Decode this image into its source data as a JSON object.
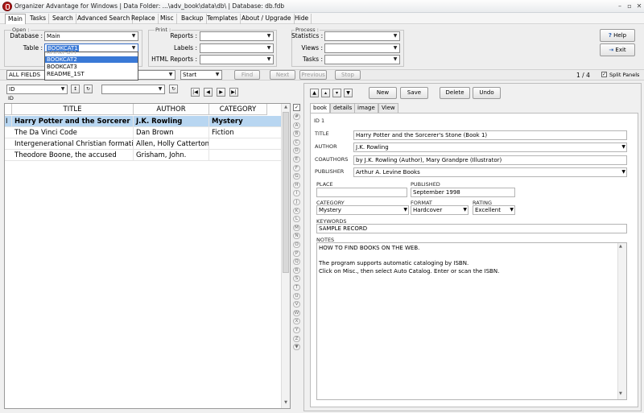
{
  "window": {
    "title": "Organizer Advantage for Windows | Data Folder: ...\\adv_book\\data\\db\\ | Database: db.fdb",
    "minimize": "–",
    "restore": "▫",
    "close": "✕"
  },
  "menu": [
    "Main",
    "Tasks",
    "Search",
    "Advanced Search",
    "Replace",
    "Misc",
    "Backup",
    "Templates",
    "About / Upgrade",
    "Hide"
  ],
  "open_group": {
    "label": "Open :",
    "database_label": "Database :",
    "database_value": "Main",
    "table_label": "Table :",
    "table_value": "BOOKCAT1",
    "table_options": [
      "BOOKCAT1",
      "BOOKCAT2",
      "BOOKCAT3",
      "README_1ST"
    ]
  },
  "print_group": {
    "label": "Print :",
    "reports_label": "Reports :",
    "labels_label": "Labels :",
    "html_reports_label": "HTML Reports :"
  },
  "process_group": {
    "label": "Process :",
    "statistics_label": "Statistics :",
    "views_label": "Views :",
    "tasks_label": "Tasks :"
  },
  "help_button": "Help",
  "exit_button": "Exit",
  "search_bar": {
    "field": "ALL FIELDS",
    "position": "Start",
    "find": "Find",
    "next": "Next",
    "previous": "Previous",
    "stop": "Stop"
  },
  "record_count": "1 / 4",
  "split_panels": "Split Panels",
  "sort_field": "ID",
  "sort_field_small": "ID",
  "grid": {
    "headers": [
      "TITLE",
      "AUTHOR",
      "CATEGORY"
    ],
    "indicator": "I",
    "rows": [
      [
        "Harry Potter and the Sorcerer",
        "J.K. Rowling",
        "Mystery"
      ],
      [
        "The Da Vinci Code",
        "Dan Brown",
        "Fiction"
      ],
      [
        "Intergenerational Christian formati",
        "Allen, Holly Catterton",
        ""
      ],
      [
        "Theodore Boone, the accused",
        "Grisham, John.",
        ""
      ]
    ]
  },
  "alphabet": [
    "#",
    "A",
    "B",
    "C",
    "D",
    "E",
    "F",
    "G",
    "H",
    "I",
    "J",
    "K",
    "L",
    "M",
    "N",
    "O",
    "P",
    "Q",
    "R",
    "S",
    "T",
    "U",
    "V",
    "W",
    "X",
    "Y",
    "Z"
  ],
  "record_buttons": {
    "new": "New",
    "save": "Save",
    "delete": "Delete",
    "undo": "Undo"
  },
  "detail_tabs": [
    "book",
    "details",
    "image",
    "View"
  ],
  "record": {
    "id": "ID 1",
    "title_label": "TITLE",
    "title": "Harry Potter and the Sorcerer's Stone (Book 1)",
    "author_label": "AUTHOR",
    "author": "J.K. Rowling",
    "coauthors_label": "COAUTHORS",
    "coauthors": "by J.K. Rowling  (Author),    Mary Grandpre (Illustrator)",
    "publisher_label": "PUBLISHER",
    "publisher": "Arthur A. Levine Books",
    "place_label": "PLACE",
    "place": "",
    "published_label": "PUBLISHED",
    "published": "September 1998",
    "category_label": "CATEGORY",
    "category": "Mystery",
    "format_label": "FORMAT",
    "format": "Hardcover",
    "rating_label": "RATING",
    "rating": "Excellent",
    "keywords_label": "KEYWORDS",
    "keywords": "SAMPLE RECORD",
    "notes_label": "NOTES",
    "notes_line1": "HOW TO FIND BOOKS ON THE WEB.",
    "notes_line2": "The program supports automatic cataloging by ISBN.",
    "notes_line3": "Click on Misc., then select Auto Catalog. Enter or scan the ISBN."
  }
}
